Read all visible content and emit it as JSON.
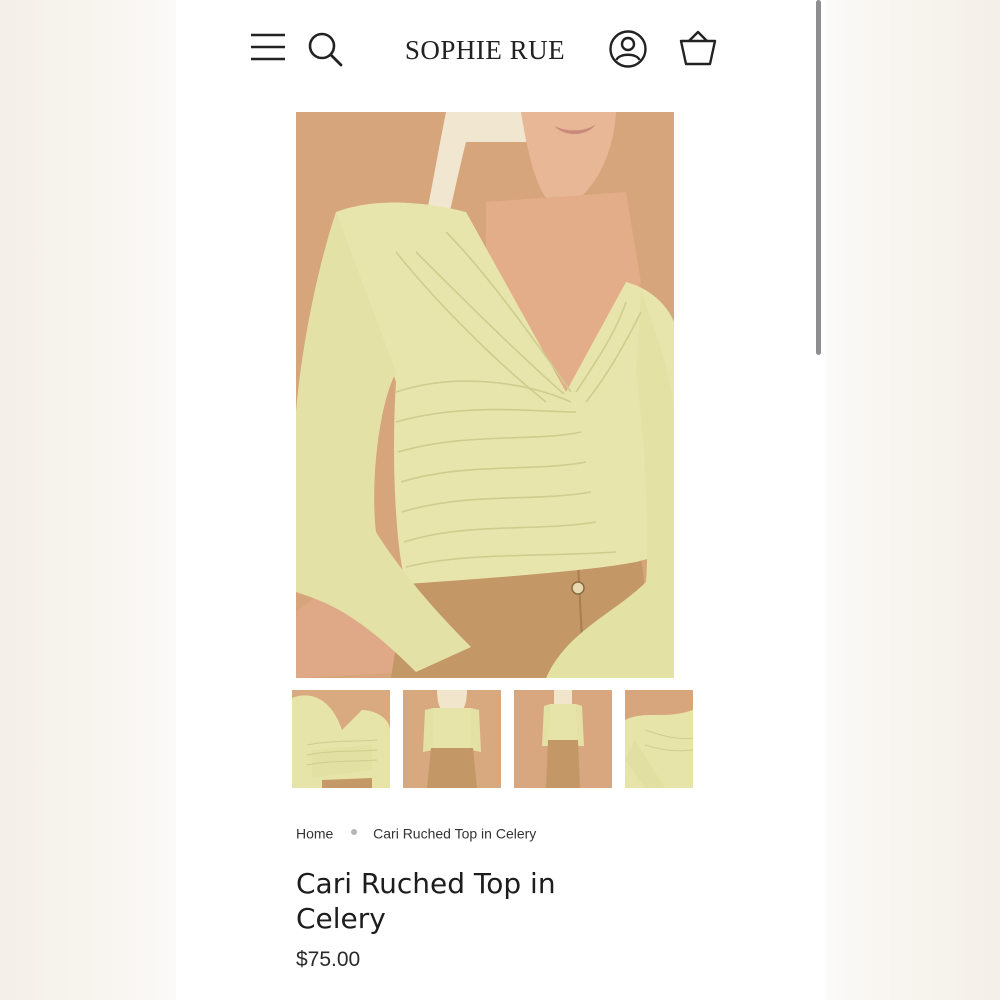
{
  "header": {
    "logo_text": "SOPHIE RUE",
    "icons": [
      "menu-icon",
      "search-icon",
      "account-icon",
      "cart-icon"
    ]
  },
  "product": {
    "title": "Cari Ruched Top in Celery",
    "price": "$75.00",
    "color_name": "Celery"
  },
  "gallery": {
    "thumbnails": [
      "front-closeup",
      "back-view",
      "full-front",
      "side-detail"
    ],
    "selected_index": 0
  },
  "breadcrumb": {
    "home": "Home",
    "current": "Cari Ruched Top in Celery"
  },
  "colors": {
    "top": "#e6e3a9",
    "background_tan": "#d8a97f",
    "pants": "#c49a6a",
    "text": "#1d1d1d",
    "underline": "#b9bdc4"
  }
}
